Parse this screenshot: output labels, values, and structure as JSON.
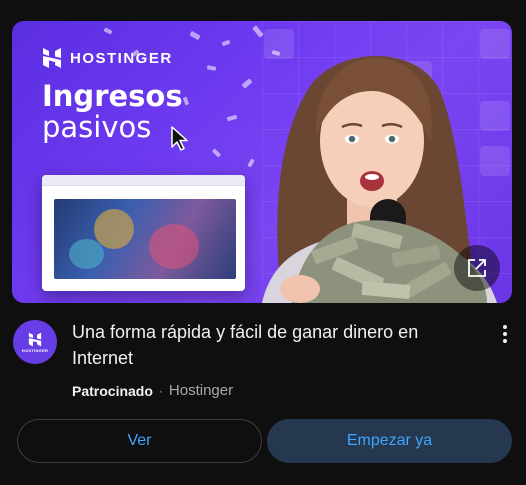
{
  "ad": {
    "brand": "HOSTINGER",
    "headline_line1": "Ingresos",
    "headline_line2": "pasivos",
    "title": "Una forma rápida y fácil de ganar dinero en Internet",
    "sponsored_label": "Patrocinado",
    "separator": "·",
    "advertiser": "Hostinger",
    "avatar_text": "HOSTINGER"
  },
  "buttons": {
    "ver_label": "Ver",
    "empezar_label": "Empezar ya"
  },
  "icons": {
    "expand": "open-external-icon",
    "more": "more-vert-icon",
    "cursor": "cursor-pointer-icon",
    "logo": "hostinger-logo-icon"
  },
  "colors": {
    "background": "#0f0f0f",
    "brand_purple": "#673de6",
    "link_blue": "#3ea6ff",
    "cta_bg": "#263850",
    "text_primary": "#f1f1f1",
    "text_secondary": "#aaaaaa"
  }
}
